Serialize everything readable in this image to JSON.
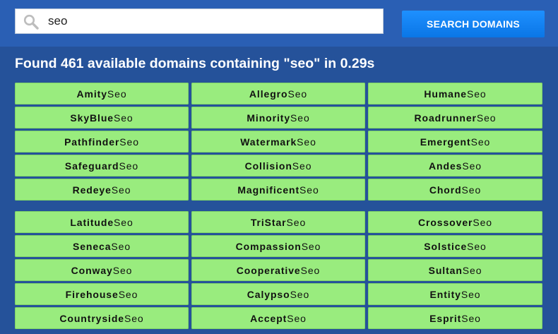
{
  "search": {
    "query": "seo",
    "button_label": "SEARCH DOMAINS",
    "icon": "search-icon"
  },
  "results": {
    "summary": "Found 461 available domains containing \"seo\" in 0.29s",
    "suffix": "Seo",
    "group_a": [
      "Amity",
      "Allegro",
      "Humane",
      "SkyBlue",
      "Minority",
      "Roadrunner",
      "Pathfinder",
      "Watermark",
      "Emergent",
      "Safeguard",
      "Collision",
      "Andes",
      "Redeye",
      "Magnificent",
      "Chord"
    ],
    "group_b": [
      "Latitude",
      "TriStar",
      "Crossover",
      "Seneca",
      "Compassion",
      "Solstice",
      "Conway",
      "Cooperative",
      "Sultan",
      "Firehouse",
      "Calypso",
      "Entity",
      "Countryside",
      "Accept",
      "Esprit"
    ]
  },
  "colors": {
    "page_background": "#25529a",
    "topbar_background": "#2a5fb4",
    "button_blue": "#1e90ff",
    "domain_green": "#99ec7e"
  }
}
